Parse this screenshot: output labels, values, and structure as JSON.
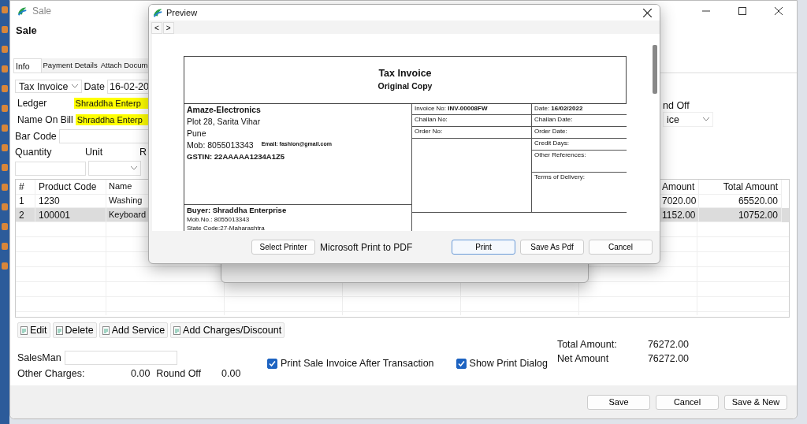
{
  "sale_window": {
    "title": "Sale",
    "heading": "Sale",
    "tabs": [
      {
        "label": "Info",
        "selected": true
      },
      {
        "label": "Payment Details",
        "selected": false
      },
      {
        "label": "Attach Docum",
        "selected": false
      }
    ],
    "voucher_type": "Tax Invoice",
    "date_label": "Date",
    "date_value": "16-02-20",
    "ledger_label": "Ledger",
    "ledger_value": "Shraddha Enterp",
    "name_on_bill_label": "Name On Bill",
    "name_on_bill_value": "Shraddha Enterp",
    "bar_code_label": "Bar Code",
    "quantity_label": "Quantity",
    "unit_label": "Unit",
    "column_3_label": "R",
    "round_off_label": "nd Off",
    "round_off_dropdown": "ice",
    "table": {
      "columns": [
        "#",
        "Product Code",
        "Name",
        "Amount",
        "Total Amount"
      ],
      "rows": [
        {
          "cells": [
            "1",
            "1230",
            "Washing",
            "7020.00",
            "65520.00"
          ],
          "selected": false
        },
        {
          "cells": [
            "2",
            "100001",
            "Keyboard",
            "1152.00",
            "10752.00"
          ],
          "selected": true
        }
      ]
    },
    "item_buttons": [
      "Edit",
      "Delete",
      "Add Service",
      "Add Charges/Discount"
    ],
    "salesman_label": "SalesMan",
    "other_charges_label": "Other Charges:",
    "other_charges_value": "0.00",
    "round_off_value_label": "Round Off",
    "round_off_value": "0.00",
    "checkboxes": [
      {
        "label": "Print Sale Invoice After Transaction",
        "checked": true
      },
      {
        "label": "Show Print Dialog",
        "checked": true
      }
    ],
    "totals": [
      {
        "label": "Total Amount:",
        "value": "76272.00"
      },
      {
        "label": "Net Amount",
        "value": "76272.00"
      }
    ],
    "footer_buttons": [
      "Save",
      "Cancel",
      "Save & New"
    ]
  },
  "preview_dialog": {
    "title": "Preview",
    "nav_buttons": [
      "<",
      ">"
    ],
    "document": {
      "title": "Tax Invoice",
      "subtitle": "Original Copy",
      "seller": {
        "name": "Amaze-Electronics",
        "address": [
          "Plot 28, Sarita Vihar",
          "Pune"
        ],
        "mobile": "Mob: 8055013343",
        "email": "Email: fashion@gmail.com",
        "gstin": "GSTIN: 22AAAAA1234A1Z5"
      },
      "buyer": {
        "name": "Buyer: Shraddha Enterprise",
        "mobile": "Mob.No.: 8055013343",
        "state": "State Code:27-Maharashtra"
      },
      "fields": [
        "Invoice No: **INV-00008FW**",
        "Date: **16/02/2022**",
        "Challan No:",
        "Challan Date:",
        "Order No:",
        "Order Date:"
      ],
      "right_fields": [
        "Credit Days:",
        "Other References:",
        "Terms of Delivery:"
      ]
    },
    "select_printer_button": "Select Printer",
    "printer_name": "Microsoft Print to PDF",
    "buttons": [
      {
        "label": "Print",
        "default": true
      },
      {
        "label": "Save As Pdf",
        "default": false
      },
      {
        "label": "Cancel",
        "default": false
      }
    ]
  }
}
